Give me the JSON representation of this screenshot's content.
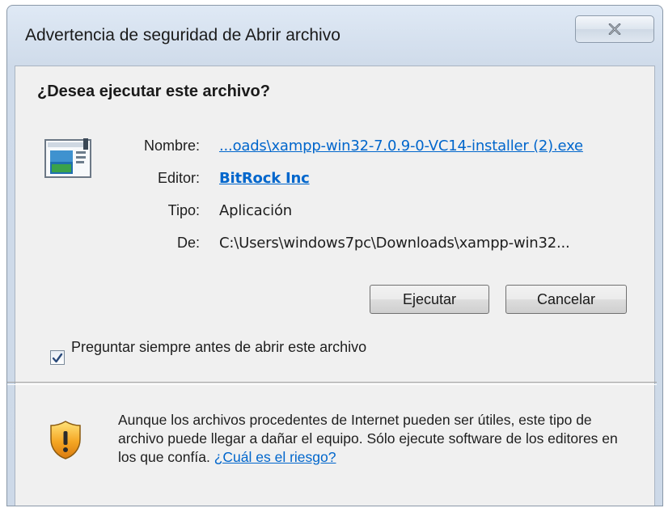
{
  "window": {
    "title": "Advertencia de seguridad de Abrir archivo",
    "close_icon": "close-icon"
  },
  "dialog": {
    "heading": "¿Desea ejecutar este archivo?",
    "fields": {
      "name_label": "Nombre:",
      "name_value": "...oads\\xampp-win32-7.0.9-0-VC14-installer (2).exe",
      "publisher_label": "Editor:",
      "publisher_value": "BitRock Inc",
      "type_label": "Tipo:",
      "type_value": "Aplicación",
      "from_label": "De:",
      "from_value": "C:\\Users\\windows7pc\\Downloads\\xampp-win32..."
    },
    "buttons": {
      "run": "Ejecutar",
      "cancel": "Cancelar"
    },
    "checkbox": {
      "label": "Preguntar siempre antes de abrir este archivo",
      "checked": true
    },
    "warning": {
      "text": "Aunque los archivos procedentes de Internet pueden ser útiles, este tipo de archivo puede llegar a dañar el equipo. Sólo ejecute software de los editores en los que confía.",
      "link": "¿Cuál es el riesgo?"
    }
  },
  "icons": {
    "app": "application-window-icon",
    "shield": "security-shield-warning-icon",
    "check": "checkmark-icon"
  },
  "colors": {
    "link": "#0066cc",
    "title_bar": "#cfdbea",
    "client_bg": "#f0f0f0"
  }
}
